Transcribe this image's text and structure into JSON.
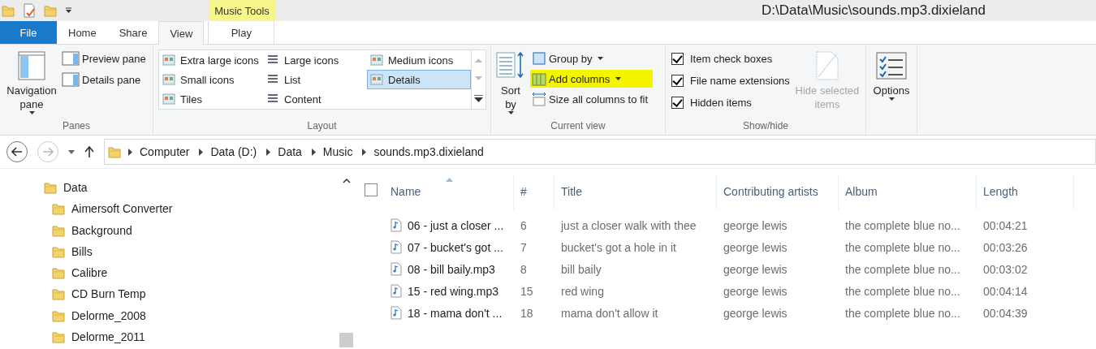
{
  "window": {
    "title": "D:\\Data\\Music\\sounds.mp3.dixieland"
  },
  "contextual_group": {
    "label": "Music Tools"
  },
  "tabs": [
    {
      "label": "File",
      "kind": "file",
      "selected": false
    },
    {
      "label": "Home",
      "kind": "normal",
      "selected": false
    },
    {
      "label": "Share",
      "kind": "normal",
      "selected": false
    },
    {
      "label": "View",
      "kind": "normal",
      "selected": true
    },
    {
      "label": "Play",
      "kind": "contextual",
      "selected": false
    }
  ],
  "ribbon": [
    {
      "kind": "panes",
      "label": "Panes",
      "large": {
        "label": "Navigation pane"
      },
      "items": [
        {
          "label": "Preview pane"
        },
        {
          "label": "Details pane"
        }
      ]
    },
    {
      "kind": "layout",
      "label": "Layout",
      "items": [
        {
          "label": "Extra large icons",
          "selected": false
        },
        {
          "label": "Large icons",
          "selected": false
        },
        {
          "label": "Medium icons",
          "selected": false
        },
        {
          "label": "Small icons",
          "selected": false
        },
        {
          "label": "List",
          "selected": false
        },
        {
          "label": "Details",
          "selected": true
        },
        {
          "label": "Tiles",
          "selected": false
        },
        {
          "label": "Content",
          "selected": false
        }
      ]
    },
    {
      "kind": "current_view",
      "label": "Current view",
      "large": {
        "label": "Sort by"
      },
      "items": [
        {
          "label": "Group by",
          "dropdown": true,
          "highlighted": false
        },
        {
          "label": "Add columns",
          "dropdown": true,
          "highlighted": true
        },
        {
          "label": "Size all columns to fit",
          "dropdown": false,
          "highlighted": false
        }
      ]
    },
    {
      "kind": "show_hide",
      "label": "Show/hide",
      "items": [
        {
          "label": "Item check boxes",
          "checked": true
        },
        {
          "label": "File name extensions",
          "checked": true
        },
        {
          "label": "Hidden items",
          "checked": true
        }
      ],
      "large": {
        "label": "Hide selected items",
        "disabled": true
      }
    },
    {
      "kind": "options",
      "large": {
        "label": "Options"
      }
    }
  ],
  "address": {
    "crumbs": [
      "Computer",
      "Data (D:)",
      "Data",
      "Music",
      "sounds.mp3.dixieland"
    ]
  },
  "navigation": [
    {
      "label": "Data",
      "children": [
        {
          "label": "Aimersoft Converter"
        },
        {
          "label": "Background"
        },
        {
          "label": "Bills"
        },
        {
          "label": "Calibre"
        },
        {
          "label": "CD Burn Temp"
        },
        {
          "label": "Delorme_2008"
        },
        {
          "label": "Delorme_2011"
        }
      ]
    }
  ],
  "files": {
    "select_all": {
      "checked": false
    },
    "columns": [
      {
        "label": "Name",
        "sorted": true
      },
      {
        "label": "#",
        "sorted": false
      },
      {
        "label": "Title",
        "sorted": false
      },
      {
        "label": "Contributing artists",
        "sorted": false
      },
      {
        "label": "Album",
        "sorted": false
      },
      {
        "label": "Length",
        "sorted": false
      }
    ],
    "rows": [
      [
        "06 - just a closer ...",
        "6",
        "just a closer walk with thee",
        "george lewis",
        "the complete blue no...",
        "00:04:21"
      ],
      [
        "07 - bucket's got ...",
        "7",
        "bucket's got a hole in it",
        "george lewis",
        "the complete blue no...",
        "00:03:26"
      ],
      [
        "08 - bill baily.mp3",
        "8",
        "bill baily",
        "george lewis",
        "the complete blue no...",
        "00:03:02"
      ],
      [
        "15 - red wing.mp3",
        "15",
        "red wing",
        "george lewis",
        "the complete blue no...",
        "00:04:14"
      ],
      [
        "18 - mama don't ...",
        "18",
        "mama don't allow it",
        "george lewis",
        "the complete blue no...",
        "00:04:39"
      ]
    ]
  }
}
